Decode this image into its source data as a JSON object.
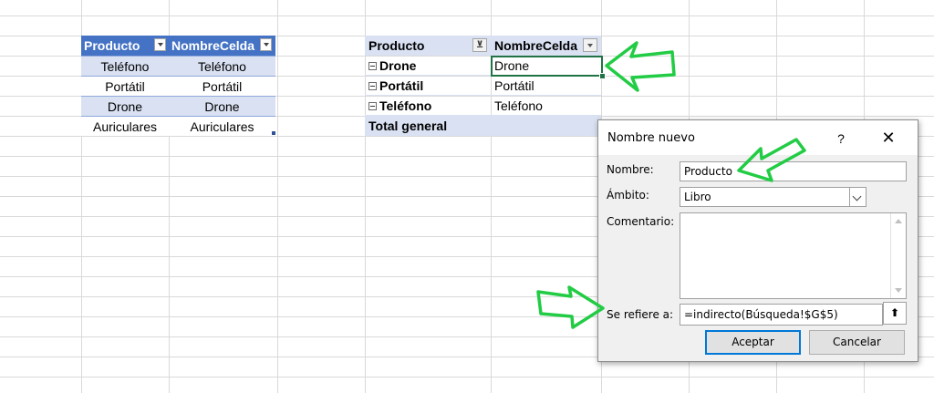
{
  "table1": {
    "headers": [
      "Producto",
      "NombreCelda"
    ],
    "rows": [
      [
        "Teléfono",
        "Teléfono"
      ],
      [
        "Portátil",
        "Portátil"
      ],
      [
        "Drone",
        "Drone"
      ],
      [
        "Auriculares",
        "Auriculares"
      ]
    ]
  },
  "pivot": {
    "headers": [
      "Producto",
      "NombreCelda"
    ],
    "filter_glyph": "⊻",
    "rows": [
      [
        "Drone",
        "Drone"
      ],
      [
        "Portátil",
        "Portátil"
      ],
      [
        "Teléfono",
        "Teléfono"
      ]
    ],
    "total_label": "Total general"
  },
  "dialog": {
    "title": "Nombre nuevo",
    "help": "?",
    "close": "✕",
    "name_label": "Nombre:",
    "name_value": "Producto",
    "scope_label": "Ámbito:",
    "scope_value": "Libro",
    "comment_label": "Comentario:",
    "refers_label": "Se refiere a:",
    "refers_value": "=indirecto(Búsqueda!$G$5)",
    "collapse_glyph": "⬆",
    "ok_label": "Aceptar",
    "cancel_label": "Cancelar"
  },
  "colors": {
    "table_header": "#4472c4",
    "table_band": "#d9e1f2",
    "pivot_header": "#d9e1f2",
    "selection": "#217346",
    "arrow_stroke": "#22cc44",
    "dialog_bg": "#f0f0f0",
    "focus": "#0078d7"
  }
}
